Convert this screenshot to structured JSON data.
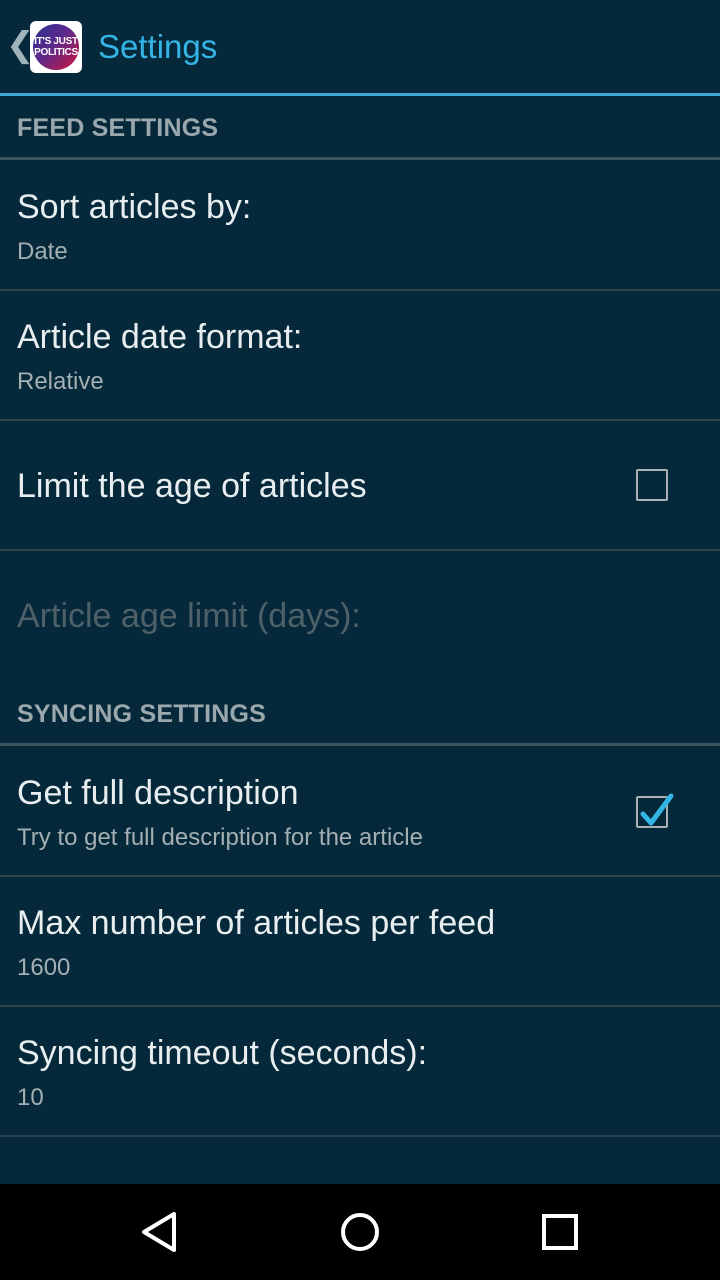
{
  "actionbar": {
    "title": "Settings",
    "up_glyph": "❮",
    "logo": {
      "line1": "IT'S JUST",
      "line2": "POLITICS"
    }
  },
  "sections": {
    "feed": {
      "header": "FEED SETTINGS",
      "sort": {
        "title": "Sort articles by:",
        "summary": "Date"
      },
      "date_format": {
        "title": "Article date format:",
        "summary": "Relative"
      },
      "limit_age": {
        "title": "Limit the age of articles",
        "checked": false
      },
      "age_limit": {
        "title": "Article age limit (days):",
        "enabled": false
      }
    },
    "syncing": {
      "header": "SYNCING SETTINGS",
      "full_description": {
        "title": "Get full description",
        "summary": "Try to get full description for the article",
        "checked": true
      },
      "max_articles": {
        "title": "Max number of articles per feed",
        "summary": "1600"
      },
      "timeout": {
        "title": "Syncing timeout (seconds):",
        "summary": "10"
      }
    }
  },
  "colors": {
    "background": "#05293a",
    "accent": "#35b5e5",
    "check_mark": "#33b5e5"
  },
  "navbar": {
    "back": "back-icon",
    "home": "home-icon",
    "recents": "recents-icon"
  }
}
